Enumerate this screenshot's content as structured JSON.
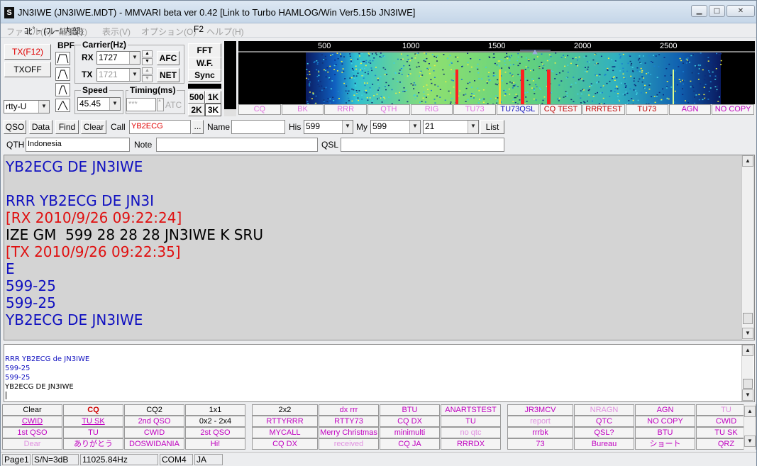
{
  "window": {
    "title": "JN3IWE (JN3IWE.MDT) - MMVARI beta ver 0.42 [Link to Turbo HAMLOG/Win Ver5.15b JN3IWE]",
    "min": "▁",
    "max": "□",
    "close": "✕"
  },
  "menu": {
    "items": [
      "ファイル(F)",
      "編集(E)",
      "表示(V)",
      "オプション(O)",
      "ヘルプ(H)"
    ],
    "ghost": "ｺﾋﾟｰ (ﾌﾚｰﾑ内部)",
    "f2": "F2"
  },
  "controls": {
    "tx": "TX(F12)",
    "txoff": "TXOFF",
    "bpf": "BPF",
    "carrier": "Carrier(Hz)",
    "rx_label": "RX",
    "tx_label": "TX",
    "rx_freq": "1727",
    "tx_freq": "1721",
    "afc": "AFC",
    "net": "NET",
    "speed_label": "Speed",
    "speed": "45.45",
    "timing_label": "Timing(ms)",
    "timing": "***",
    "atc": "ATC",
    "mode": "rtty-U",
    "fft": "FFT",
    "wf": "W.F.",
    "sync": "Sync",
    "b500": "500",
    "b1k": "1K",
    "b2k": "2K",
    "b3k": "3K"
  },
  "scale": [
    "500",
    "1000",
    "1500",
    "2000",
    "2500"
  ],
  "macros": [
    {
      "t": "CQ",
      "c": "#e070e0"
    },
    {
      "t": "BK",
      "c": "#e070e0"
    },
    {
      "t": "RRR",
      "c": "#e070e0"
    },
    {
      "t": "QTH",
      "c": "#e070e0"
    },
    {
      "t": "RIG",
      "c": "#e070e0"
    },
    {
      "t": "TU73",
      "c": "#e070e0"
    },
    {
      "t": "TU73QSL",
      "c": "#1010c0"
    },
    {
      "t": "CQ TEST",
      "c": "#c00000"
    },
    {
      "t": "RRRTEST",
      "c": "#c00000"
    },
    {
      "t": "TU73",
      "c": "#c00000"
    },
    {
      "t": "AGN",
      "c": "#c000c0"
    },
    {
      "t": "NO COPY",
      "c": "#c000c0"
    }
  ],
  "log": {
    "qso": "QSO",
    "data": "Data",
    "find": "Find",
    "clear": "Clear",
    "call_label": "Call",
    "call": "YB2ECG",
    "dots": "...",
    "name_label": "Name",
    "his_label": "His",
    "his": "599",
    "my_label": "My",
    "my": "599",
    "band": "21",
    "list": "List",
    "qth_label": "QTH",
    "qth": "Indonesia",
    "note_label": "Note",
    "qsl_label": "QSL"
  },
  "rx": [
    {
      "t": "YB2ECG DE JN3IWE",
      "c": "#1010c0"
    },
    {
      "t": "",
      "c": "#000"
    },
    {
      "t": "RRR YB2ECG DE JN3I",
      "c": "#1010c0"
    },
    {
      "t": "[RX 2010/9/26 09:22:24]",
      "c": "#e01010"
    },
    {
      "t": "IZE GM  599 28 28 28 JN3IWE K SRU",
      "c": "#000"
    },
    {
      "t": "[TX 2010/9/26 09:22:35]",
      "c": "#e01010"
    },
    {
      "t": "E",
      "c": "#1010c0"
    },
    {
      "t": "599-25",
      "c": "#1010c0"
    },
    {
      "t": "599-25",
      "c": "#1010c0"
    },
    {
      "t": "YB2ECG DE JN3IWE",
      "c": "#1010c0"
    }
  ],
  "tx": [
    {
      "t": "RRR YB2ECG de JN3IWE",
      "c": "#1010c0"
    },
    {
      "t": "599-25",
      "c": "#1010c0"
    },
    {
      "t": "599-25",
      "c": "#1010c0"
    },
    {
      "t": "YB2ECG DE JN3IWE",
      "c": "#000"
    }
  ],
  "buttons": [
    [
      {
        "t": "Clear",
        "c": "#000"
      },
      {
        "t": "CQ",
        "c": "#d00000",
        "b": true
      },
      {
        "t": "CQ2",
        "c": "#000"
      },
      {
        "t": "1x1",
        "c": "#000"
      },
      {
        "t": "2x2",
        "c": "#000"
      },
      {
        "t": "dx rrr",
        "c": "#c000c0"
      },
      {
        "t": "BTU",
        "c": "#c000c0"
      },
      {
        "t": "ANARTSTEST",
        "c": "#c000c0"
      },
      {
        "t": "JR3MCV",
        "c": "#c000c0"
      },
      {
        "t": "NRAGN",
        "c": "#e090e0"
      },
      {
        "t": "AGN",
        "c": "#c000c0"
      },
      {
        "t": "TU",
        "c": "#e090e0"
      }
    ],
    [
      {
        "t": "CWID",
        "c": "#c000c0",
        "u": true
      },
      {
        "t": "TU SK",
        "c": "#c000c0",
        "u": true
      },
      {
        "t": "2nd QSO",
        "c": "#c000c0"
      },
      {
        "t": "0x2 - 2x4",
        "c": "#000"
      },
      {
        "t": "RTTYRRR",
        "c": "#c000c0"
      },
      {
        "t": "RTTY73",
        "c": "#c000c0"
      },
      {
        "t": "CQ DX",
        "c": "#c000c0"
      },
      {
        "t": "TU",
        "c": "#c000c0"
      },
      {
        "t": "report",
        "c": "#e090e0"
      },
      {
        "t": "QTC",
        "c": "#c000c0"
      },
      {
        "t": "NO COPY",
        "c": "#c000c0"
      },
      {
        "t": "CWID",
        "c": "#c000c0"
      }
    ],
    [
      {
        "t": "1st QSO",
        "c": "#c000c0"
      },
      {
        "t": "TU",
        "c": "#c000c0"
      },
      {
        "t": "CWID",
        "c": "#c000c0"
      },
      {
        "t": "2st QSO",
        "c": "#c000c0"
      },
      {
        "t": "MYCALL",
        "c": "#c000c0"
      },
      {
        "t": "Merry Christmas",
        "c": "#c000c0"
      },
      {
        "t": "minimulti",
        "c": "#c000c0"
      },
      {
        "t": "no qtc",
        "c": "#e090e0"
      },
      {
        "t": "rrrbk",
        "c": "#c000c0"
      },
      {
        "t": "QSL?",
        "c": "#c000c0"
      },
      {
        "t": "BTU",
        "c": "#c000c0"
      },
      {
        "t": "TU SK",
        "c": "#c000c0"
      }
    ],
    [
      {
        "t": "Dear",
        "c": "#e090e0"
      },
      {
        "t": "ありがとう",
        "c": "#c000c0"
      },
      {
        "t": "DOSWIDANIA",
        "c": "#c000c0"
      },
      {
        "t": "Hi!",
        "c": "#c000c0"
      },
      {
        "t": "CQ DX",
        "c": "#c000c0"
      },
      {
        "t": "received",
        "c": "#e090e0"
      },
      {
        "t": "CQ JA",
        "c": "#c000c0"
      },
      {
        "t": "RRRDX",
        "c": "#c000c0"
      },
      {
        "t": "73",
        "c": "#c000c0"
      },
      {
        "t": "Bureau",
        "c": "#c000c0"
      },
      {
        "t": "ショート",
        "c": "#c000c0"
      },
      {
        "t": "QRZ",
        "c": "#c000c0"
      }
    ]
  ],
  "status": {
    "page": "Page1",
    "sn": "S/N=3dB",
    "clock": "11025.84Hz",
    "port": "COM4",
    "lang": "JA"
  }
}
